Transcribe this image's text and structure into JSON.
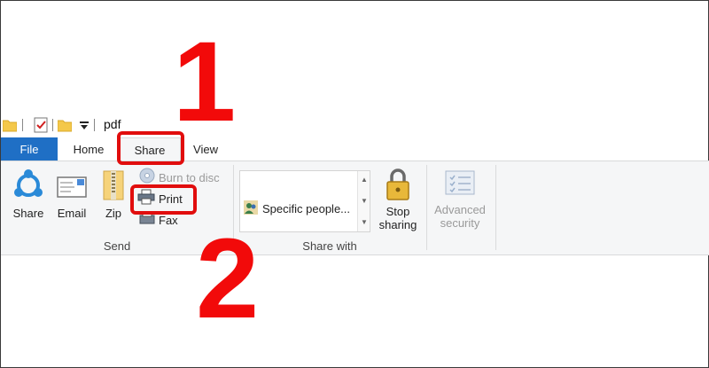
{
  "title_bar": {
    "folder_title": "pdf",
    "icons": [
      "folder-icon",
      "properties-check-icon",
      "new-folder-icon",
      "customize-dropdown-icon"
    ]
  },
  "tabs": [
    {
      "label": "File"
    },
    {
      "label": "Home"
    },
    {
      "label": "Share"
    },
    {
      "label": "View"
    }
  ],
  "ribbon": {
    "send": {
      "share_label": "Share",
      "email_label": "Email",
      "zip_label": "Zip",
      "burn_label": "Burn to disc",
      "print_label": "Print",
      "fax_label": "Fax",
      "group_label": "Send"
    },
    "share_with": {
      "gallery_item": "Specific people...",
      "stop_sharing_label_1": "Stop",
      "stop_sharing_label_2": "sharing",
      "group_label": "Share with"
    },
    "advanced": {
      "label_1": "Advanced",
      "label_2": "security",
      "disabled": true
    }
  },
  "annotations": {
    "step_1": "1",
    "step_2": "2",
    "color": "#f20a0a"
  },
  "colors": {
    "file_tab": "#1f6fc5",
    "ribbon_bg": "#f5f6f7"
  }
}
